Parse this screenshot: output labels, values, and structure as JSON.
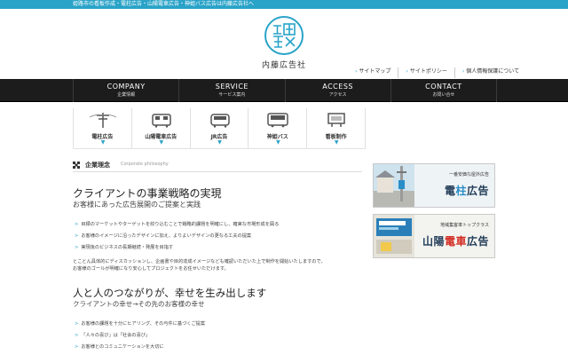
{
  "top_bar": {
    "text": "姫路市の看板作成・電柱広告・山陽電車広告・神姫バス広告は内藤広告社へ"
  },
  "logo": {
    "mark": "内藤\n広告",
    "name": "内藤広告社"
  },
  "util_links": [
    {
      "label": "サイトマップ"
    },
    {
      "label": "サイトポリシー"
    },
    {
      "label": "個人情報保護について"
    }
  ],
  "global_nav": [
    {
      "en": "COMPANY",
      "ja": "企業情報"
    },
    {
      "en": "SERVICE",
      "ja": "サービス案内"
    },
    {
      "en": "ACCESS",
      "ja": "アクセス"
    },
    {
      "en": "CONTACT",
      "ja": "お問い合せ"
    }
  ],
  "service_nav": [
    {
      "label": "電柱広告",
      "icon": "utility-pole-icon"
    },
    {
      "label": "山陽電車広告",
      "icon": "train-icon"
    },
    {
      "label": "JR広告",
      "icon": "train-icon"
    },
    {
      "label": "神姫バス",
      "icon": "bus-icon"
    },
    {
      "label": "看板制作",
      "icon": "signboard-icon"
    }
  ],
  "section": {
    "title_ja": "企業理念",
    "title_en": "Corporate philosophy"
  },
  "content": {
    "heading1": "クライアントの事業戦略の実現",
    "subheading1": "お客様にあった広告展開のご提案と実践",
    "list1": [
      "目標のマーケットやターゲットを絞り込むことで戦略的課題を明確にし、確実な市場形成を図る",
      "お客様のイメージに沿ったデザインに加え、よりよいデザインの更なる工夫の提案",
      "実現後のビジネスの長期継続・発展を目指す"
    ],
    "paragraph_lines": [
      "とことん具体的にディスカッションし、企画書や目的達成イメージなども確認いただいた上で制作を開始いたしますので、",
      "お客様のゴールが明確になり安心してプロジェクトをお任せいただけます。"
    ],
    "heading2": "人と人のつながりが、幸せを生み出します",
    "subheading2": "クライアントの幸せ→その先のお客様の幸せ",
    "list2": [
      "お客様の課題を十分にヒアリング、その与件に基づくご提案",
      "「人々の喜び」は「社会の喜び」",
      "お客様とのコミュニケーションを大切に"
    ]
  },
  "banners": [
    {
      "small": "一番安価な屋外広告",
      "big": "電柱広告",
      "big_highlight": "柱",
      "big_pre": "電",
      "big_post": "広告"
    },
    {
      "small": "地域集客率トップクラス",
      "big": "山陽電車広告",
      "big_pre": "山陽",
      "big_highlight": "電車",
      "big_post": "広告"
    }
  ],
  "colors": {
    "accent": "#2aa3c8",
    "nav_bg": "#1c1c1c",
    "banner_text": "#1f3a56"
  }
}
